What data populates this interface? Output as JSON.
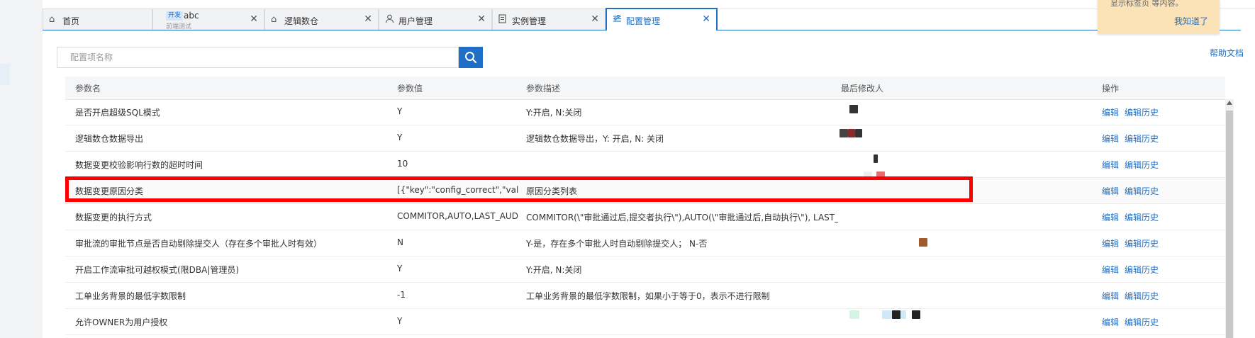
{
  "tabs": [
    {
      "label": "首页",
      "icon": "home-icon"
    },
    {
      "badge": "开发",
      "label": "abc",
      "sublabel": "前端测试"
    },
    {
      "label": "逻辑数仓",
      "icon": "home-icon"
    },
    {
      "label": "用户管理",
      "icon": "user-icon"
    },
    {
      "label": "实例管理",
      "icon": "instance-icon"
    },
    {
      "label": "配置管理",
      "icon": "settings-icon",
      "active": true
    }
  ],
  "tooltip": {
    "text": "显示标签页 等内容。",
    "ok": "我知道了"
  },
  "search": {
    "placeholder": "配置项名称",
    "value": ""
  },
  "help_link": "帮助文档",
  "table": {
    "headers": [
      "参数名",
      "参数值",
      "参数描述",
      "最后修改人",
      "操作"
    ],
    "rows": [
      {
        "name": "是否开启超级SQL模式",
        "value": "Y",
        "desc": "Y:开启, N:关闭"
      },
      {
        "name": "逻辑数仓数据导出",
        "value": "Y",
        "desc": "逻辑数仓数据导出，Y: 开启, N: 关闭"
      },
      {
        "name": "数据变更校验影响行数的超时时间",
        "value": "10",
        "desc": ""
      },
      {
        "name": "数据变更原因分类",
        "value": "[{\"key\":\"config_correct\",\"value\":",
        "desc": "原因分类列表"
      },
      {
        "name": "数据变更的执行方式",
        "value": "COMMITOR,AUTO,LAST_AUD",
        "desc": "COMMITOR(\\\"审批通过后,提交者执行\\\"),AUTO(\\\"审批通过后,自动执行\\\"), LAST_AU"
      },
      {
        "name": "审批流的审批节点是否自动剔除提交人（存在多个审批人时有效）",
        "value": "N",
        "desc": "Y-是，存在多个审批人时自动剔除提交人； N-否"
      },
      {
        "name": "开启工作流审批可越权模式(限DBA|管理员)",
        "value": "Y",
        "desc": "Y:开启, N:关闭"
      },
      {
        "name": "工单业务背景的最低字数限制",
        "value": "-1",
        "desc": "工单业务背景的最低字数限制，如果小于等于0，表示不进行限制"
      },
      {
        "name": "允许OWNER为用户授权",
        "value": "Y",
        "desc": ""
      }
    ],
    "actions": {
      "edit": "编辑",
      "history": "编辑历史"
    }
  },
  "colors": {
    "accent": "#1f6fc6",
    "highlight": "#ff0000",
    "tooltip_bg": "#fbe3b7"
  }
}
